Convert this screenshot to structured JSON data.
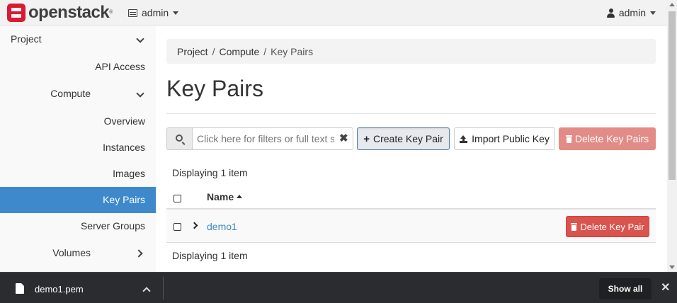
{
  "navbar": {
    "brand": "openstack",
    "brand_mark": "®",
    "project_label": "admin",
    "user_label": "admin"
  },
  "sidebar": {
    "items": [
      {
        "label": "Project",
        "kind": "section",
        "expanded": true
      },
      {
        "label": "API Access",
        "kind": "item"
      },
      {
        "label": "Compute",
        "kind": "sub",
        "expanded": true
      },
      {
        "label": "Overview",
        "kind": "item"
      },
      {
        "label": "Instances",
        "kind": "item"
      },
      {
        "label": "Images",
        "kind": "item"
      },
      {
        "label": "Key Pairs",
        "kind": "item",
        "active": true
      },
      {
        "label": "Server Groups",
        "kind": "item"
      },
      {
        "label": "Volumes",
        "kind": "sub",
        "expanded": false
      }
    ]
  },
  "breadcrumb": [
    "Project",
    "Compute",
    "Key Pairs"
  ],
  "breadcrumb_sep": "/",
  "page": {
    "title": "Key Pairs"
  },
  "toolbar": {
    "search_placeholder": "Click here for filters or full text search.",
    "clear_symbol": "✖",
    "create_label": "Create Key Pair",
    "create_symbol": "+",
    "import_label": "Import Public Key",
    "delete_label": "Delete Key Pairs"
  },
  "table": {
    "count_text": "Displaying 1 item",
    "columns": [
      "Name"
    ],
    "sort": "ascending",
    "rows": [
      {
        "name": "demo1",
        "action": "Delete Key Pair"
      }
    ]
  },
  "download_bar": {
    "file_name": "demo1.pem",
    "show_all": "Show all",
    "close_symbol": "✕"
  },
  "colors": {
    "brand": "#da1a32",
    "active_nav": "#3d89cc",
    "danger": "#d9534f",
    "danger_disabled": "#e38c87",
    "link": "#3d89cc"
  }
}
